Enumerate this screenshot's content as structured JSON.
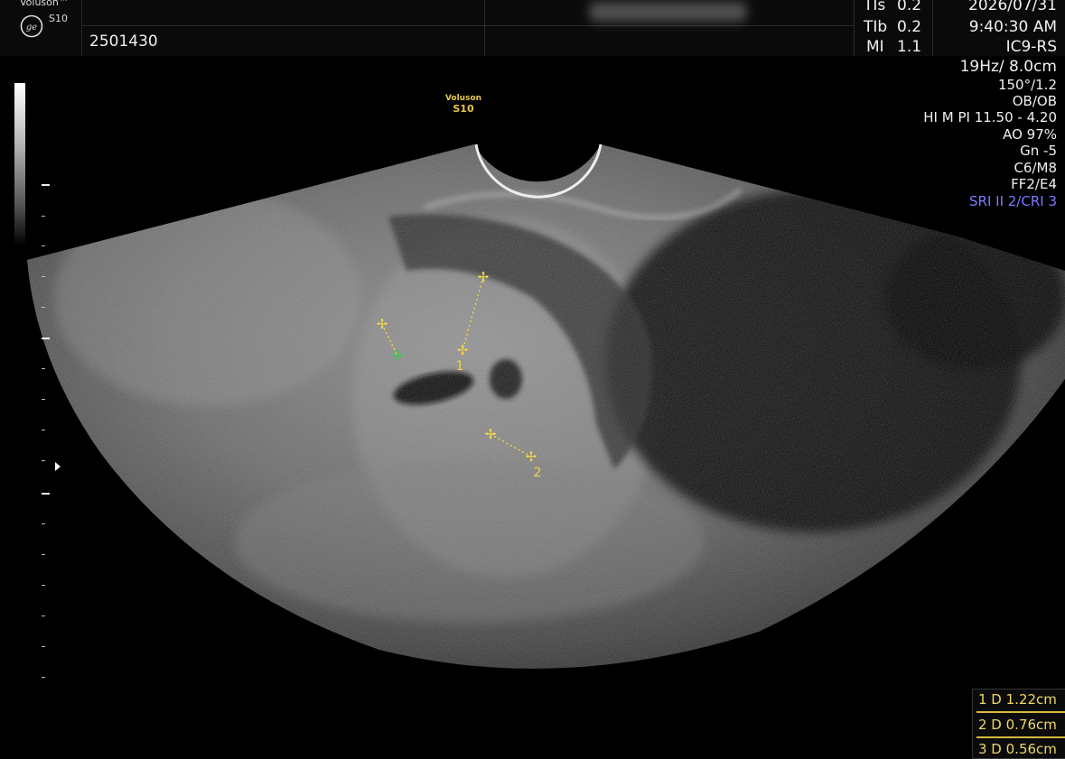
{
  "header": {
    "brand_top": "Voluson™",
    "brand_model": "S10",
    "patient_id": "2501430",
    "indices": [
      {
        "label": "TIs",
        "value": "0.2"
      },
      {
        "label": "TIb",
        "value": "0.2"
      },
      {
        "label": "MI",
        "value": "1.1"
      }
    ],
    "date": "2026/07/31",
    "time": "9:40:30 AM"
  },
  "probe": "IC9-RS",
  "params": {
    "depth": "19Hz/ 8.0cm",
    "angle": "150°/1.2",
    "mode": "OB/OB",
    "harmonic": "HI M PI 11.50 - 4.20",
    "ao": "AO 97%",
    "gain": "Gn  -5",
    "cm": "C6/M8",
    "ff": "FF2/E4",
    "sri": "SRI II 2/CRI 3"
  },
  "image_label": {
    "line1": "Voluson",
    "line2": "S10"
  },
  "calipers": [
    {
      "number": "1"
    },
    {
      "number": "2"
    }
  ],
  "measurements": [
    {
      "text": "1  D 1.22cm"
    },
    {
      "text": "2  D 0.76cm"
    },
    {
      "text": "3  D 0.56cm"
    }
  ],
  "colors": {
    "caliper": "#f2d64b",
    "active_caliper": "#2fd14a",
    "sri": "#7a7aff"
  },
  "icons": [
    "ge-logo-icon",
    "focus-marker-icon"
  ]
}
